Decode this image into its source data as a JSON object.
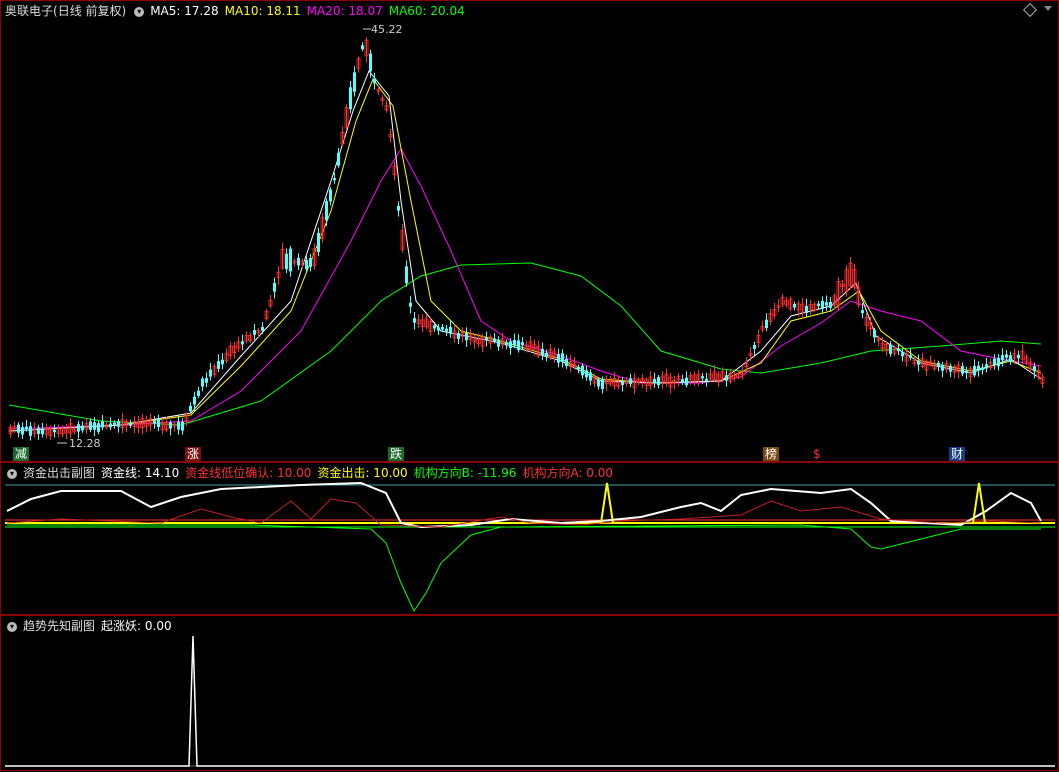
{
  "main": {
    "title": "奥联电子",
    "period": "(日线 前复权)",
    "ma5": {
      "label": "MA5: 17.28",
      "color": "#ffffff"
    },
    "ma10": {
      "label": "MA10: 18.11",
      "color": "#ffff00"
    },
    "ma20": {
      "label": "MA20: 18.07",
      "color": "#ff00ff"
    },
    "ma60": {
      "label": "MA60: 20.04",
      "color": "#00ff00"
    },
    "high_label": "45.22",
    "low_label": "12.28",
    "markers": [
      {
        "text": "减",
        "bg": "#1d6b2a",
        "color": "#ffffff"
      },
      {
        "text": "涨",
        "bg": "#7a1010",
        "color": "#ffffff"
      },
      {
        "text": "跌",
        "bg": "#1d6b2a",
        "color": "#ffffff"
      },
      {
        "text": "榜",
        "bg": "#7a4a10",
        "color": "#ffffff"
      },
      {
        "text": "$",
        "bg": "transparent",
        "color": "#ff3030"
      },
      {
        "text": "财",
        "bg": "#1a3a8a",
        "color": "#ffffff"
      }
    ]
  },
  "sub1": {
    "title": "资金出击副图",
    "items": [
      {
        "label": "资金线: 14.10",
        "color": "#ffffff"
      },
      {
        "label": "资金线低位确认: 10.00",
        "color": "#ff3030"
      },
      {
        "label": "资金出击: 10.00",
        "color": "#ffff00"
      },
      {
        "label": "机构方向B: -11.96",
        "color": "#00ff00"
      },
      {
        "label": "机构方向A: 0.00",
        "color": "#ff3030"
      }
    ]
  },
  "sub2": {
    "title": "趋势先知副图",
    "items": [
      {
        "label": "起涨妖: 0.00",
        "color": "#ffffff"
      }
    ]
  }
}
